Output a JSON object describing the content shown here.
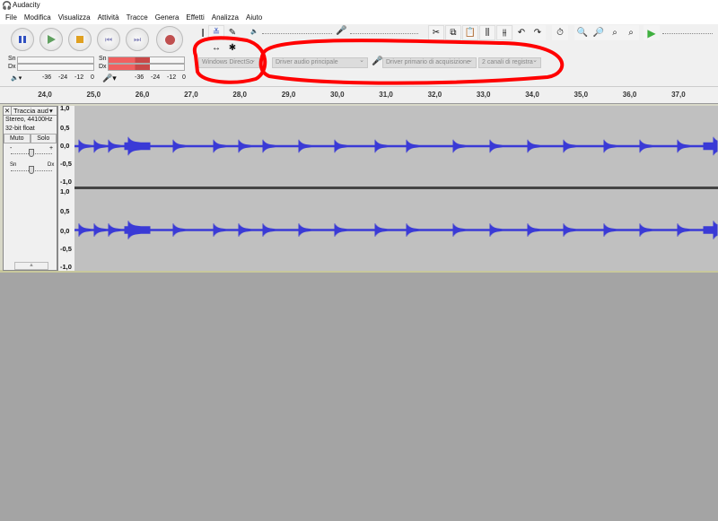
{
  "title": "Audacity",
  "menu": [
    "File",
    "Modifica",
    "Visualizza",
    "Attività",
    "Tracce",
    "Genera",
    "Effetti",
    "Analizza",
    "Aiuto"
  ],
  "meters": {
    "play_left": "Sn",
    "play_right": "Dx",
    "rec_left": "Sn",
    "rec_right": "Dx",
    "scale": [
      "-36",
      "-24",
      "-12",
      "0"
    ]
  },
  "device": {
    "host": "Windows DirectSo",
    "playback": "Driver audio principale",
    "recording": "Driver primario di acquisizione",
    "channels": "2 canali di registra"
  },
  "ruler": [
    "24,0",
    "25,0",
    "26,0",
    "27,0",
    "28,0",
    "29,0",
    "30,0",
    "31,0",
    "32,0",
    "33,0",
    "34,0",
    "35,0",
    "36,0",
    "37,0"
  ],
  "track": {
    "name": "Traccia aud",
    "info1": "Stereo, 44100Hz",
    "info2": "32-bit float",
    "mute": "Muto",
    "solo": "Solo",
    "gain_min": "-",
    "gain_max": "+",
    "pan_left": "Sn",
    "pan_right": "Dx",
    "scale": [
      "1,0",
      "0,5",
      "0,0",
      "-0,5",
      "-1,0"
    ]
  },
  "colors": {
    "wave": "#3a3ad6",
    "annotation": "#ff0000",
    "record": "#c05050"
  }
}
